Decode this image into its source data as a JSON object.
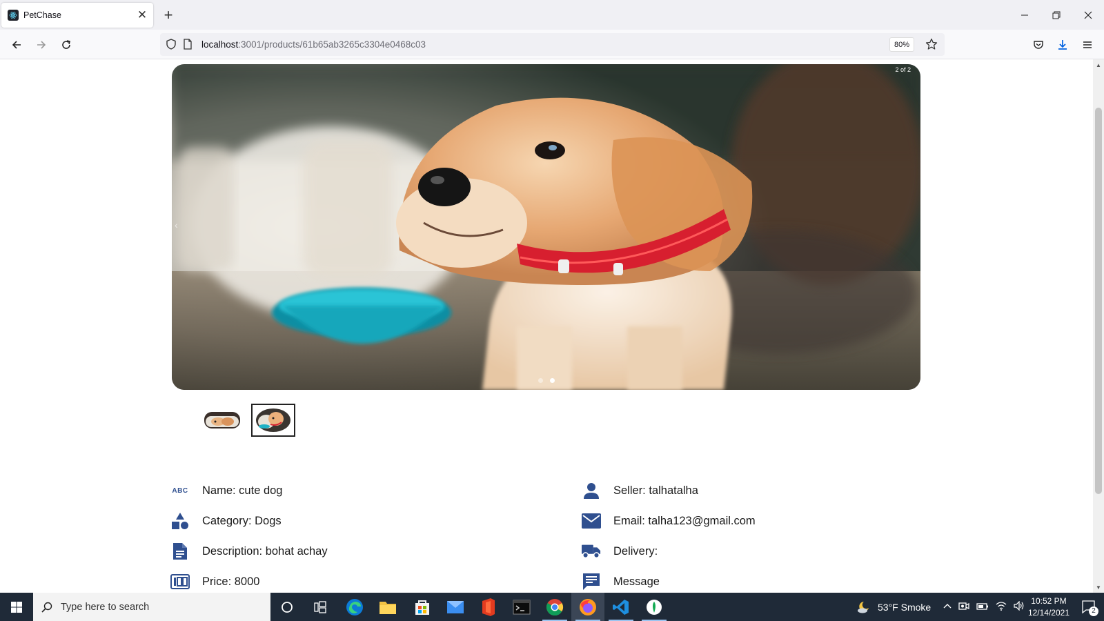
{
  "browser": {
    "tab_title": "PetChase",
    "url_host": "localhost",
    "url_path": ":3001/products/61b65ab3265c3304e0468c03",
    "zoom": "80%"
  },
  "carousel": {
    "slide_counter": "2 of 2",
    "slide_count": 2,
    "active_slide": 2
  },
  "product": {
    "name": "Name: cute dog",
    "category": "Category: Dogs",
    "description": "Description: bohat achay",
    "price": "Price: 8000",
    "seller": "Seller: talhatalha",
    "email": "Email: talha123@gmail.com",
    "delivery": "Delivery:",
    "message": "Message",
    "abc_icon_text": "ABC"
  },
  "taskbar": {
    "search_placeholder": "Type here to search",
    "weather": "53°F  Smoke",
    "time": "10:52 PM",
    "date": "12/14/2021",
    "notification_count": "2"
  },
  "colors": {
    "icon_blue": "#2f4f8f",
    "taskbar_bg": "#1f2a38"
  }
}
